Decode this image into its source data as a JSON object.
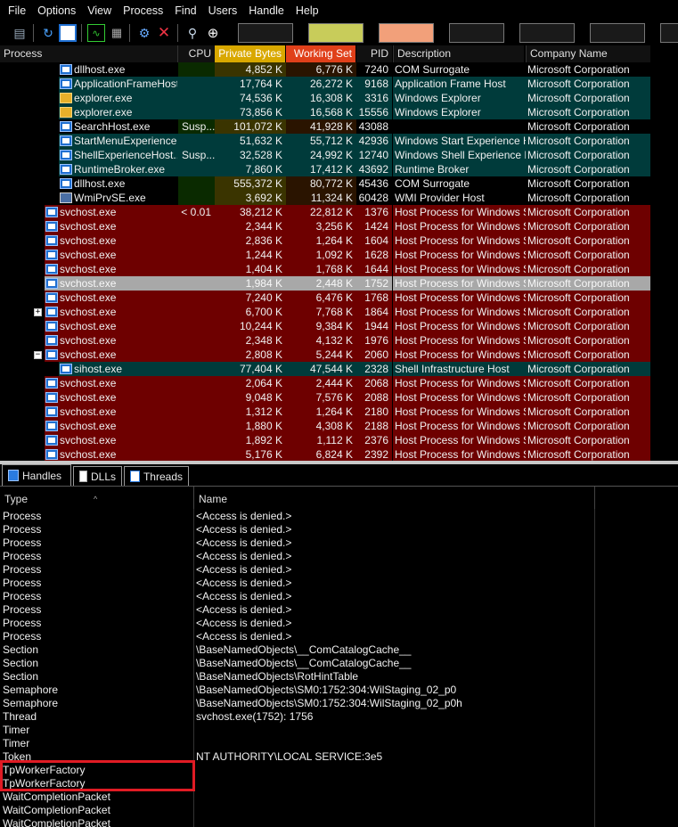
{
  "menu": [
    "File",
    "Options",
    "View",
    "Process",
    "Find",
    "Users",
    "Handle",
    "Help"
  ],
  "toolbar": {
    "icons": [
      "save-icon",
      "refresh-icon",
      "window-icon",
      "graph-icon",
      "cpu-icon",
      "settings-target-icon",
      "kill-icon",
      "find-icon",
      "crosshair-icon"
    ],
    "graph_colors": [
      "#1a1a1a",
      "#c8cc5a",
      "#1a1a1a",
      "#f2a07a",
      "#1a1a1a",
      "#1a1a1a",
      "#1a1a1a"
    ]
  },
  "colors": {
    "service_row": "#6e0000",
    "own_row": "#003b3b",
    "selected_row": "#a8a8a8",
    "private_bytes_header": "#d9a800",
    "working_set_header": "#e0401a",
    "cpu_column": "#0a2a00",
    "private_column": "#3a3400",
    "working_column": "#2a1400",
    "highlight_box": "#e01b24"
  },
  "process_table": {
    "headers": {
      "process": "Process",
      "cpu": "CPU",
      "private": "Private Bytes",
      "working": "Working Set",
      "pid": "PID",
      "desc": "Description",
      "company": "Company Name"
    },
    "rows": [
      {
        "name": "dllhost.exe",
        "icon": "win",
        "indent": 1,
        "cpu": "",
        "private": "4,852 K",
        "working": "6,776 K",
        "pid": "7240",
        "desc": "COM Surrogate",
        "company": "Microsoft Corporation",
        "style": "plain"
      },
      {
        "name": "ApplicationFrameHost...",
        "icon": "win",
        "indent": 1,
        "cpu": "",
        "private": "17,764 K",
        "working": "26,272 K",
        "pid": "9168",
        "desc": "Application Frame Host",
        "company": "Microsoft Corporation",
        "style": "own"
      },
      {
        "name": "explorer.exe",
        "icon": "folder",
        "indent": 1,
        "cpu": "",
        "private": "74,536 K",
        "working": "16,308 K",
        "pid": "3316",
        "desc": "Windows Explorer",
        "company": "Microsoft Corporation",
        "style": "own"
      },
      {
        "name": "explorer.exe",
        "icon": "folder",
        "indent": 1,
        "cpu": "",
        "private": "73,856 K",
        "working": "16,568 K",
        "pid": "15556",
        "desc": "Windows Explorer",
        "company": "Microsoft Corporation",
        "style": "own"
      },
      {
        "name": "SearchHost.exe",
        "icon": "win",
        "indent": 1,
        "cpu": "Susp...",
        "private": "101,072 K",
        "working": "41,928 K",
        "pid": "43088",
        "desc": "",
        "company": "Microsoft Corporation",
        "style": "plain"
      },
      {
        "name": "StartMenuExperience...",
        "icon": "win",
        "indent": 1,
        "cpu": "",
        "private": "51,632 K",
        "working": "55,712 K",
        "pid": "42936",
        "desc": "Windows Start Experience H...",
        "company": "Microsoft Corporation",
        "style": "own"
      },
      {
        "name": "ShellExperienceHost....",
        "icon": "win",
        "indent": 1,
        "cpu": "Susp...",
        "private": "32,528 K",
        "working": "24,992 K",
        "pid": "12740",
        "desc": "Windows Shell Experience H...",
        "company": "Microsoft Corporation",
        "style": "own"
      },
      {
        "name": "RuntimeBroker.exe",
        "icon": "win",
        "indent": 1,
        "cpu": "",
        "private": "7,860 K",
        "working": "17,412 K",
        "pid": "43692",
        "desc": "Runtime Broker",
        "company": "Microsoft Corporation",
        "style": "own"
      },
      {
        "name": "dllhost.exe",
        "icon": "win",
        "indent": 1,
        "cpu": "",
        "private": "555,372 K",
        "working": "80,772 K",
        "pid": "45436",
        "desc": "COM Surrogate",
        "company": "Microsoft Corporation",
        "style": "plain"
      },
      {
        "name": "WmiPrvSE.exe",
        "icon": "wmi",
        "indent": 1,
        "cpu": "",
        "private": "3,692 K",
        "working": "11,324 K",
        "pid": "60428",
        "desc": "WMI Provider Host",
        "company": "Microsoft Corporation",
        "style": "plain"
      },
      {
        "name": "svchost.exe",
        "icon": "win",
        "indent": 0,
        "cpu": "< 0.01",
        "private": "38,212 K",
        "working": "22,812 K",
        "pid": "1376",
        "desc": "Host Process for Windows S...",
        "company": "Microsoft Corporation",
        "style": "service"
      },
      {
        "name": "svchost.exe",
        "icon": "win",
        "indent": 0,
        "cpu": "",
        "private": "2,344 K",
        "working": "3,256 K",
        "pid": "1424",
        "desc": "Host Process for Windows S...",
        "company": "Microsoft Corporation",
        "style": "service"
      },
      {
        "name": "svchost.exe",
        "icon": "win",
        "indent": 0,
        "cpu": "",
        "private": "2,836 K",
        "working": "1,264 K",
        "pid": "1604",
        "desc": "Host Process for Windows S...",
        "company": "Microsoft Corporation",
        "style": "service"
      },
      {
        "name": "svchost.exe",
        "icon": "win",
        "indent": 0,
        "cpu": "",
        "private": "1,244 K",
        "working": "1,092 K",
        "pid": "1628",
        "desc": "Host Process for Windows S...",
        "company": "Microsoft Corporation",
        "style": "service"
      },
      {
        "name": "svchost.exe",
        "icon": "win",
        "indent": 0,
        "cpu": "",
        "private": "1,404 K",
        "working": "1,768 K",
        "pid": "1644",
        "desc": "Host Process for Windows S...",
        "company": "Microsoft Corporation",
        "style": "service"
      },
      {
        "name": "svchost.exe",
        "icon": "win",
        "indent": 0,
        "cpu": "",
        "private": "1,984 K",
        "working": "2,448 K",
        "pid": "1752",
        "desc": "Host Process for Windows S...",
        "company": "Microsoft Corporation",
        "style": "selected"
      },
      {
        "name": "svchost.exe",
        "icon": "win",
        "indent": 0,
        "cpu": "",
        "private": "7,240 K",
        "working": "6,476 K",
        "pid": "1768",
        "desc": "Host Process for Windows S...",
        "company": "Microsoft Corporation",
        "style": "service"
      },
      {
        "name": "svchost.exe",
        "icon": "win",
        "indent": 0,
        "cpu": "",
        "private": "6,700 K",
        "working": "7,768 K",
        "pid": "1864",
        "desc": "Host Process for Windows S...",
        "company": "Microsoft Corporation",
        "style": "service",
        "expander": "+"
      },
      {
        "name": "svchost.exe",
        "icon": "win",
        "indent": 0,
        "cpu": "",
        "private": "10,244 K",
        "working": "9,384 K",
        "pid": "1944",
        "desc": "Host Process for Windows S...",
        "company": "Microsoft Corporation",
        "style": "service"
      },
      {
        "name": "svchost.exe",
        "icon": "win",
        "indent": 0,
        "cpu": "",
        "private": "2,348 K",
        "working": "4,132 K",
        "pid": "1976",
        "desc": "Host Process for Windows S...",
        "company": "Microsoft Corporation",
        "style": "service"
      },
      {
        "name": "svchost.exe",
        "icon": "win",
        "indent": 0,
        "cpu": "",
        "private": "2,808 K",
        "working": "5,244 K",
        "pid": "2060",
        "desc": "Host Process for Windows S...",
        "company": "Microsoft Corporation",
        "style": "service",
        "expander": "−"
      },
      {
        "name": "sihost.exe",
        "icon": "win",
        "indent": 1,
        "cpu": "",
        "private": "77,404 K",
        "working": "47,544 K",
        "pid": "2328",
        "desc": "Shell Infrastructure Host",
        "company": "Microsoft Corporation",
        "style": "own"
      },
      {
        "name": "svchost.exe",
        "icon": "win",
        "indent": 0,
        "cpu": "",
        "private": "2,064 K",
        "working": "2,444 K",
        "pid": "2068",
        "desc": "Host Process for Windows S...",
        "company": "Microsoft Corporation",
        "style": "service"
      },
      {
        "name": "svchost.exe",
        "icon": "win",
        "indent": 0,
        "cpu": "",
        "private": "9,048 K",
        "working": "7,576 K",
        "pid": "2088",
        "desc": "Host Process for Windows S...",
        "company": "Microsoft Corporation",
        "style": "service"
      },
      {
        "name": "svchost.exe",
        "icon": "win",
        "indent": 0,
        "cpu": "",
        "private": "1,312 K",
        "working": "1,264 K",
        "pid": "2180",
        "desc": "Host Process for Windows S...",
        "company": "Microsoft Corporation",
        "style": "service"
      },
      {
        "name": "svchost.exe",
        "icon": "win",
        "indent": 0,
        "cpu": "",
        "private": "1,880 K",
        "working": "4,308 K",
        "pid": "2188",
        "desc": "Host Process for Windows S...",
        "company": "Microsoft Corporation",
        "style": "service"
      },
      {
        "name": "svchost.exe",
        "icon": "win",
        "indent": 0,
        "cpu": "",
        "private": "1,892 K",
        "working": "1,112 K",
        "pid": "2376",
        "desc": "Host Process for Windows S...",
        "company": "Microsoft Corporation",
        "style": "service"
      },
      {
        "name": "svchost.exe",
        "icon": "win",
        "indent": 0,
        "cpu": "",
        "private": "5,176 K",
        "working": "6,824 K",
        "pid": "2392",
        "desc": "Host Process for Windows S...",
        "company": "Microsoft Corporation",
        "style": "service"
      }
    ]
  },
  "tabs": [
    {
      "label": "Handles",
      "icon": "handles-icon",
      "active": true
    },
    {
      "label": "DLLs",
      "icon": "dlls-icon",
      "active": false
    },
    {
      "label": "Threads",
      "icon": "threads-icon",
      "active": false
    }
  ],
  "handles_table": {
    "headers": {
      "type": "Type",
      "name": "Name"
    },
    "rows": [
      {
        "type": "Process",
        "name": "<Access is denied.>"
      },
      {
        "type": "Process",
        "name": "<Access is denied.>"
      },
      {
        "type": "Process",
        "name": "<Access is denied.>"
      },
      {
        "type": "Process",
        "name": "<Access is denied.>"
      },
      {
        "type": "Process",
        "name": "<Access is denied.>"
      },
      {
        "type": "Process",
        "name": "<Access is denied.>"
      },
      {
        "type": "Process",
        "name": "<Access is denied.>"
      },
      {
        "type": "Process",
        "name": "<Access is denied.>"
      },
      {
        "type": "Process",
        "name": "<Access is denied.>"
      },
      {
        "type": "Process",
        "name": "<Access is denied.>"
      },
      {
        "type": "Section",
        "name": "\\BaseNamedObjects\\__ComCatalogCache__"
      },
      {
        "type": "Section",
        "name": "\\BaseNamedObjects\\__ComCatalogCache__"
      },
      {
        "type": "Section",
        "name": "\\BaseNamedObjects\\RotHintTable"
      },
      {
        "type": "Semaphore",
        "name": "\\BaseNamedObjects\\SM0:1752:304:WilStaging_02_p0"
      },
      {
        "type": "Semaphore",
        "name": "\\BaseNamedObjects\\SM0:1752:304:WilStaging_02_p0h"
      },
      {
        "type": "Thread",
        "name": "svchost.exe(1752): 1756"
      },
      {
        "type": "Timer",
        "name": ""
      },
      {
        "type": "Timer",
        "name": ""
      },
      {
        "type": "Token",
        "name": "NT AUTHORITY\\LOCAL SERVICE:3e5"
      },
      {
        "type": "TpWorkerFactory",
        "name": ""
      },
      {
        "type": "TpWorkerFactory",
        "name": ""
      },
      {
        "type": "WaitCompletionPacket",
        "name": ""
      },
      {
        "type": "WaitCompletionPacket",
        "name": ""
      },
      {
        "type": "WaitCompletionPacket",
        "name": ""
      }
    ]
  }
}
